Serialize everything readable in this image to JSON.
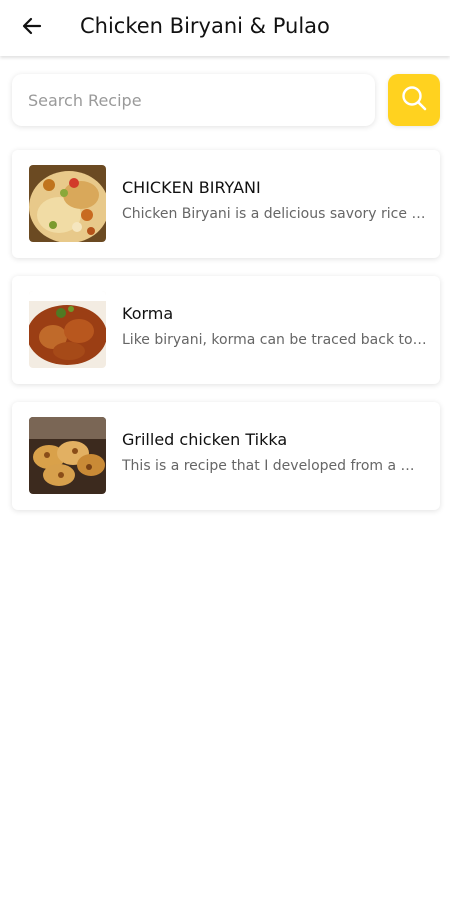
{
  "header": {
    "title": "Chicken Biryani & Pulao",
    "back_icon": "arrow-left-icon"
  },
  "search": {
    "placeholder": "Search Recipe",
    "value": "",
    "button_icon": "search-icon",
    "button_color": "#ffd21f"
  },
  "recipes": [
    {
      "name": "CHICKEN BIRYANI",
      "description": "Chicken Biryani is a delicious savory rice dish"
    },
    {
      "name": "Korma",
      "description": "Like biryani, korma can be traced back to the Mughal era"
    },
    {
      "name": "Grilled chicken Tikka",
      "description": "This is a recipe that I developed from a marinade"
    }
  ]
}
